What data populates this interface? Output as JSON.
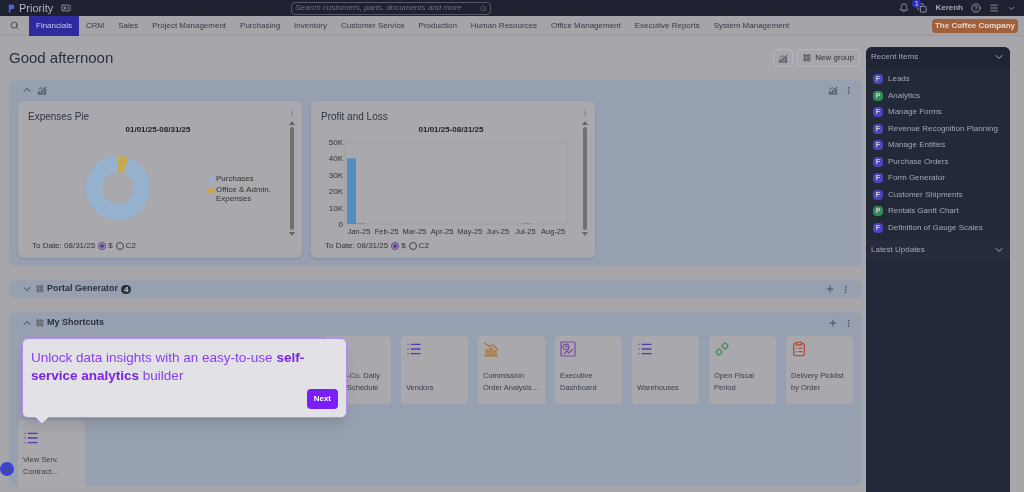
{
  "topbar": {
    "brand": "Priority",
    "search": {
      "placeholder": "Search customers, parts, documents and more"
    },
    "notification_count": "1",
    "user": "Kerenh"
  },
  "nav": {
    "tabs": [
      {
        "label": "Financials",
        "selected": true
      },
      {
        "label": "CRM",
        "selected": false
      },
      {
        "label": "Sales",
        "selected": false
      },
      {
        "label": "Project Management",
        "selected": false
      },
      {
        "label": "Purchasing",
        "selected": false
      },
      {
        "label": "Inventory",
        "selected": false
      },
      {
        "label": "Customer Service",
        "selected": false
      },
      {
        "label": "Production",
        "selected": false
      },
      {
        "label": "Human Resources",
        "selected": false
      },
      {
        "label": "Office Management",
        "selected": false
      },
      {
        "label": "Executive Reports",
        "selected": false
      },
      {
        "label": "System Management",
        "selected": false
      }
    ],
    "company": "The Coffee Company"
  },
  "greeting": "Good afternoon",
  "toolbar": {
    "new_group": "New group"
  },
  "analytics_group": {
    "expanded": true,
    "widgets": [
      {
        "kind": "donut",
        "title": "Expenses Pie",
        "range": "01/01/25-08/31/25",
        "legend": [
          {
            "label": "Purchases",
            "color": "#8fb4d9"
          },
          {
            "label": "Office & Admin. Expenses",
            "color": "#d9a520"
          }
        ],
        "footer": {
          "label": "To Date: 08/31/25",
          "options": [
            {
              "label": "$",
              "selected": true
            },
            {
              "label": "C2",
              "selected": false
            }
          ]
        }
      },
      {
        "kind": "bar",
        "title": "Profit and Loss",
        "range": "01/01/25-08/31/25",
        "chart_data": {
          "type": "bar",
          "categories": [
            "Jan-25",
            "Feb-25",
            "Mar-25",
            "Apr-25",
            "May-25",
            "Jun-25",
            "Jul-25",
            "Aug-25"
          ],
          "series": [
            {
              "color": "#3a86c8",
              "values": [
                40000,
                0,
                0,
                0,
                0,
                0,
                0,
                0
              ]
            },
            {
              "color": "#4caf50",
              "values": [
                600,
                0,
                0,
                0,
                0,
                0,
                600,
                0
              ]
            }
          ],
          "ylim": [
            0,
            50000
          ],
          "yticks": [
            {
              "value": 0,
              "label": "0"
            },
            {
              "value": 10000,
              "label": "10K"
            },
            {
              "value": 20000,
              "label": "20K"
            },
            {
              "value": 30000,
              "label": "30K"
            },
            {
              "value": 40000,
              "label": "40K"
            },
            {
              "value": 50000,
              "label": "50K"
            }
          ]
        },
        "footer": {
          "label": "To Date: 08/31/25",
          "options": [
            {
              "label": "$",
              "selected": true
            },
            {
              "label": "C2",
              "selected": false
            }
          ]
        }
      }
    ]
  },
  "portal_group": {
    "title": "Portal Generator",
    "count": "4",
    "expanded": false
  },
  "shortcuts_group": {
    "title": "My Shortcuts",
    "expanded": true,
    "shortcuts": [
      {
        "kind": "partial",
        "label": "-Co. Daily Schedule"
      },
      {
        "kind": "list",
        "label": "Vendors"
      },
      {
        "kind": "chart",
        "label": "Commission Order Analysis…"
      },
      {
        "kind": "dashboard",
        "label": "Executive Dashboard"
      },
      {
        "kind": "list",
        "label": "Warehouses"
      },
      {
        "kind": "gears",
        "label": "Open Fiscal Period"
      },
      {
        "kind": "picklist",
        "label": "Delivery Picklist by Order"
      },
      {
        "kind": "list",
        "label": "View Serv. Contract…"
      }
    ]
  },
  "tooltip": {
    "text": "Unlock data insights with an easy-to-use **self-service analytics** builder",
    "button": "Next"
  },
  "recent": {
    "title": "Recent Items",
    "expanded": true,
    "items": [
      {
        "badge": "F",
        "color": "#4a45b8",
        "label": "Leads"
      },
      {
        "badge": "P",
        "color": "#2f8a55",
        "label": "Analytics"
      },
      {
        "badge": "F",
        "color": "#4a45b8",
        "label": "Manage Forms"
      },
      {
        "badge": "F",
        "color": "#4a45b8",
        "label": "Revenue Recognition Planning"
      },
      {
        "badge": "F",
        "color": "#4a45b8",
        "label": "Manage Entities"
      },
      {
        "badge": "F",
        "color": "#4a45b8",
        "label": "Purchase Orders"
      },
      {
        "badge": "F",
        "color": "#4a45b8",
        "label": "Form Generator"
      },
      {
        "badge": "F",
        "color": "#4a45b8",
        "label": "Customer Shipments"
      },
      {
        "badge": "P",
        "color": "#2f8a55",
        "label": "Rentals Gantt Chart"
      },
      {
        "badge": "F",
        "color": "#4a45b8",
        "label": "Definition of Gauge Scales"
      }
    ]
  },
  "updates": {
    "title": "Latest Updates",
    "expanded": false
  }
}
